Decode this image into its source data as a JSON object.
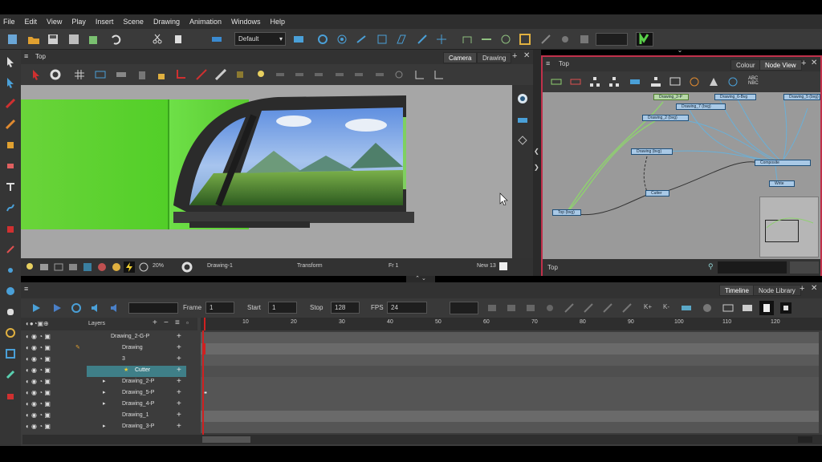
{
  "menu": [
    "File",
    "Edit",
    "View",
    "Play",
    "Insert",
    "Scene",
    "Drawing",
    "Animation",
    "Windows",
    "Help"
  ],
  "toolbar": {
    "workspace": "Default"
  },
  "camera_view": {
    "title": "Top",
    "tabs": [
      "Camera",
      "Drawing"
    ],
    "status": {
      "zoom": "20%",
      "drawing": "Drawing-1",
      "tool": "Transform",
      "frame": "Fr 1",
      "new": "New 13"
    }
  },
  "node_view": {
    "title": "Top",
    "tabs": [
      "Colour",
      "Node View"
    ],
    "nodes": [
      "Drawing_2-P",
      "Drawing_6-Bvg",
      "Drawing_7 (bvg)",
      "Drawing_5 (bvg)",
      "Drawing_2 (bvg)",
      "Drawing (bvg)",
      "Composite",
      "Cutter",
      "Write",
      "Top (bvg)"
    ],
    "footer_label": "Top"
  },
  "timeline": {
    "tabs": [
      "Timeline",
      "Node Library"
    ],
    "frame_label": "Frame",
    "frame_value": "1",
    "start_label": "Start",
    "start_value": "1",
    "stop_label": "Stop",
    "stop_value": "128",
    "fps_label": "FPS",
    "fps_value": "24",
    "layers_header": "Layers",
    "ruler": [
      "10",
      "20",
      "30",
      "40",
      "50",
      "60",
      "70",
      "80",
      "90",
      "100",
      "110",
      "120"
    ],
    "layers": [
      {
        "name": "Drawing_2-G-P",
        "indent": 0
      },
      {
        "name": "Drawing",
        "indent": 1
      },
      {
        "name": "3",
        "indent": 1
      },
      {
        "name": "Cutter",
        "indent": 2,
        "selected": true
      },
      {
        "name": "Drawing_2-P",
        "indent": 1
      },
      {
        "name": "Drawing_5-P",
        "indent": 1
      },
      {
        "name": "Drawing_4-P",
        "indent": 1
      },
      {
        "name": "Drawing_1",
        "indent": 1
      },
      {
        "name": "Drawing_3-P",
        "indent": 1
      }
    ]
  },
  "colors": {
    "accent": "#5ca0d0",
    "selected_layer": "#3f7f88",
    "node_border": "#c0314b",
    "playhead": "#d02020"
  }
}
